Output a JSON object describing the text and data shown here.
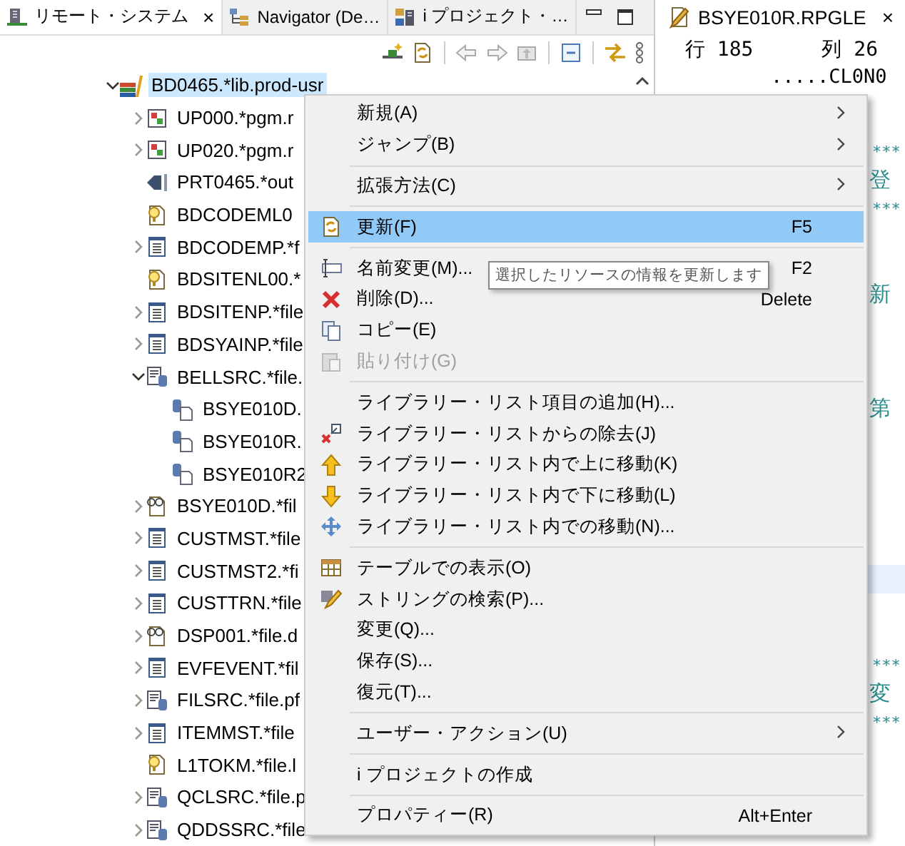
{
  "left_tabs": [
    {
      "label": "リモート・システム",
      "selected": true,
      "close": "×"
    },
    {
      "label": "Navigator (De…",
      "selected": false
    },
    {
      "label": "i プロジェクト・…",
      "selected": false
    }
  ],
  "tree": {
    "items": [
      {
        "label": "BD0465.*lib.prod-usr",
        "kind": "library",
        "expanded": true,
        "selected": true,
        "children": [
          {
            "label": "UP000.*pgm.r",
            "kind": "program",
            "expanded": false,
            "selected": false
          },
          {
            "label": "UP020.*pgm.r",
            "kind": "program",
            "expanded": false,
            "selected": false
          },
          {
            "label": "PRT0465.*out",
            "kind": "outq",
            "selected": false
          },
          {
            "label": "BDCODEML0",
            "kind": "logical",
            "selected": false
          },
          {
            "label": "BDCODEMP.*f",
            "kind": "physical",
            "expanded": false,
            "selected": false
          },
          {
            "label": "BDSITENL00.*",
            "kind": "logical",
            "selected": false
          },
          {
            "label": "BDSITENP.*file",
            "kind": "physical",
            "expanded": false,
            "selected": false
          },
          {
            "label": "BDSYAINP.*file",
            "kind": "physical",
            "expanded": false,
            "selected": false
          },
          {
            "label": "BELLSRC.*file.",
            "kind": "source",
            "expanded": true,
            "selected": false,
            "children": [
              {
                "label": "BSYE010D.",
                "kind": "member",
                "selected": false
              },
              {
                "label": "BSYE010R.",
                "kind": "member",
                "selected": false
              },
              {
                "label": "BSYE010R2",
                "kind": "member",
                "selected": false
              }
            ]
          },
          {
            "label": "BSYE010D.*fil",
            "kind": "display",
            "expanded": false,
            "selected": false
          },
          {
            "label": "CUSTMST.*file",
            "kind": "physical",
            "expanded": false,
            "selected": false
          },
          {
            "label": "CUSTMST2.*fi",
            "kind": "physical",
            "expanded": false,
            "selected": false
          },
          {
            "label": "CUSTTRN.*file",
            "kind": "physical",
            "expanded": false,
            "selected": false
          },
          {
            "label": "DSP001.*file.d",
            "kind": "display",
            "expanded": false,
            "selected": false
          },
          {
            "label": "EVFEVENT.*fil",
            "kind": "physical",
            "expanded": false,
            "selected": false
          },
          {
            "label": "FILSRC.*file.pf",
            "kind": "source",
            "expanded": false,
            "selected": false
          },
          {
            "label": "ITEMMST.*file",
            "kind": "physical",
            "expanded": false,
            "selected": false
          },
          {
            "label": "L1TOKM.*file.l",
            "kind": "logical",
            "selected": false
          },
          {
            "label": "QCLSRC.*file.p",
            "kind": "source",
            "expanded": false,
            "selected": false
          },
          {
            "label": "QDDSSRC.*file",
            "kind": "source",
            "expanded": false,
            "selected": false
          }
        ]
      }
    ]
  },
  "context_menu": {
    "items": [
      {
        "kind": "plain",
        "label": "新規(A)",
        "submenu": true,
        "selected": false,
        "disabled": false
      },
      {
        "kind": "plain",
        "label": "ジャンプ(B)",
        "submenu": true,
        "selected": false,
        "disabled": false
      },
      {
        "kind": "separator"
      },
      {
        "kind": "plain",
        "label": "拡張方法(C)",
        "submenu": true,
        "selected": false,
        "disabled": false
      },
      {
        "kind": "separator"
      },
      {
        "kind": "refresh",
        "label": "更新(F)",
        "shortcut": "F5",
        "submenu": false,
        "selected": true,
        "disabled": false
      },
      {
        "kind": "separator"
      },
      {
        "kind": "rename",
        "label": "名前変更(M)...",
        "shortcut": "F2",
        "submenu": false,
        "selected": false,
        "disabled": false
      },
      {
        "kind": "delete",
        "label": "削除(D)...",
        "shortcut": "Delete",
        "submenu": false,
        "selected": false,
        "disabled": false
      },
      {
        "kind": "copy",
        "label": "コピー(E)",
        "submenu": false,
        "selected": false,
        "disabled": false
      },
      {
        "kind": "paste",
        "label": "貼り付け(G)",
        "submenu": false,
        "selected": false,
        "disabled": true
      },
      {
        "kind": "separator"
      },
      {
        "kind": "plain",
        "label": "ライブラリー・リスト項目の追加(H)...",
        "submenu": false,
        "selected": false,
        "disabled": false
      },
      {
        "kind": "remove",
        "label": "ライブラリー・リストからの除去(J)",
        "submenu": false,
        "selected": false,
        "disabled": false
      },
      {
        "kind": "up",
        "label": "ライブラリー・リスト内で上に移動(K)",
        "submenu": false,
        "selected": false,
        "disabled": false
      },
      {
        "kind": "down",
        "label": "ライブラリー・リスト内で下に移動(L)",
        "submenu": false,
        "selected": false,
        "disabled": false
      },
      {
        "kind": "move",
        "label": "ライブラリー・リスト内での移動(N)...",
        "submenu": false,
        "selected": false,
        "disabled": false
      },
      {
        "kind": "separator"
      },
      {
        "kind": "table",
        "label": "テーブルでの表示(O)",
        "submenu": false,
        "selected": false,
        "disabled": false
      },
      {
        "kind": "search",
        "label": "ストリングの検索(P)...",
        "submenu": false,
        "selected": false,
        "disabled": false
      },
      {
        "kind": "plain",
        "label": "変更(Q)...",
        "submenu": false,
        "selected": false,
        "disabled": false
      },
      {
        "kind": "plain",
        "label": "保存(S)...",
        "submenu": false,
        "selected": false,
        "disabled": false
      },
      {
        "kind": "plain",
        "label": "復元(T)...",
        "submenu": false,
        "selected": false,
        "disabled": false
      },
      {
        "kind": "separator"
      },
      {
        "kind": "plain",
        "label": "ユーザー・アクション(U)",
        "submenu": true,
        "selected": false,
        "disabled": false
      },
      {
        "kind": "separator"
      },
      {
        "kind": "plain",
        "label": "i プロジェクトの作成",
        "submenu": false,
        "selected": false,
        "disabled": false
      },
      {
        "kind": "separator"
      },
      {
        "kind": "plain",
        "label": "プロパティー(R)",
        "shortcut": "Alt+Enter",
        "submenu": false,
        "selected": false,
        "disabled": false
      }
    ]
  },
  "tooltip": "選択したリソースの情報を更新します",
  "editor": {
    "tab": {
      "label": "BSYE010R.RPGLE",
      "close": "×"
    },
    "position": {
      "line": "行 185",
      "column": "列 26"
    },
    "ruler": ".....CL0N0",
    "lines": [
      {
        "kind": "stars",
        "text": "***",
        "current": false
      },
      {
        "kind": "text",
        "text": "登",
        "current": false
      },
      {
        "kind": "stars",
        "text": "***",
        "current": false
      },
      {
        "kind": "text",
        "text": "新",
        "current": false
      },
      {
        "kind": "text",
        "text": "第",
        "current": false
      },
      {
        "kind": "blank",
        "current": true
      },
      {
        "kind": "stars",
        "text": "***",
        "current": false
      },
      {
        "kind": "text",
        "text": "変",
        "current": false
      },
      {
        "kind": "stars",
        "text": "***",
        "current": false
      }
    ]
  }
}
